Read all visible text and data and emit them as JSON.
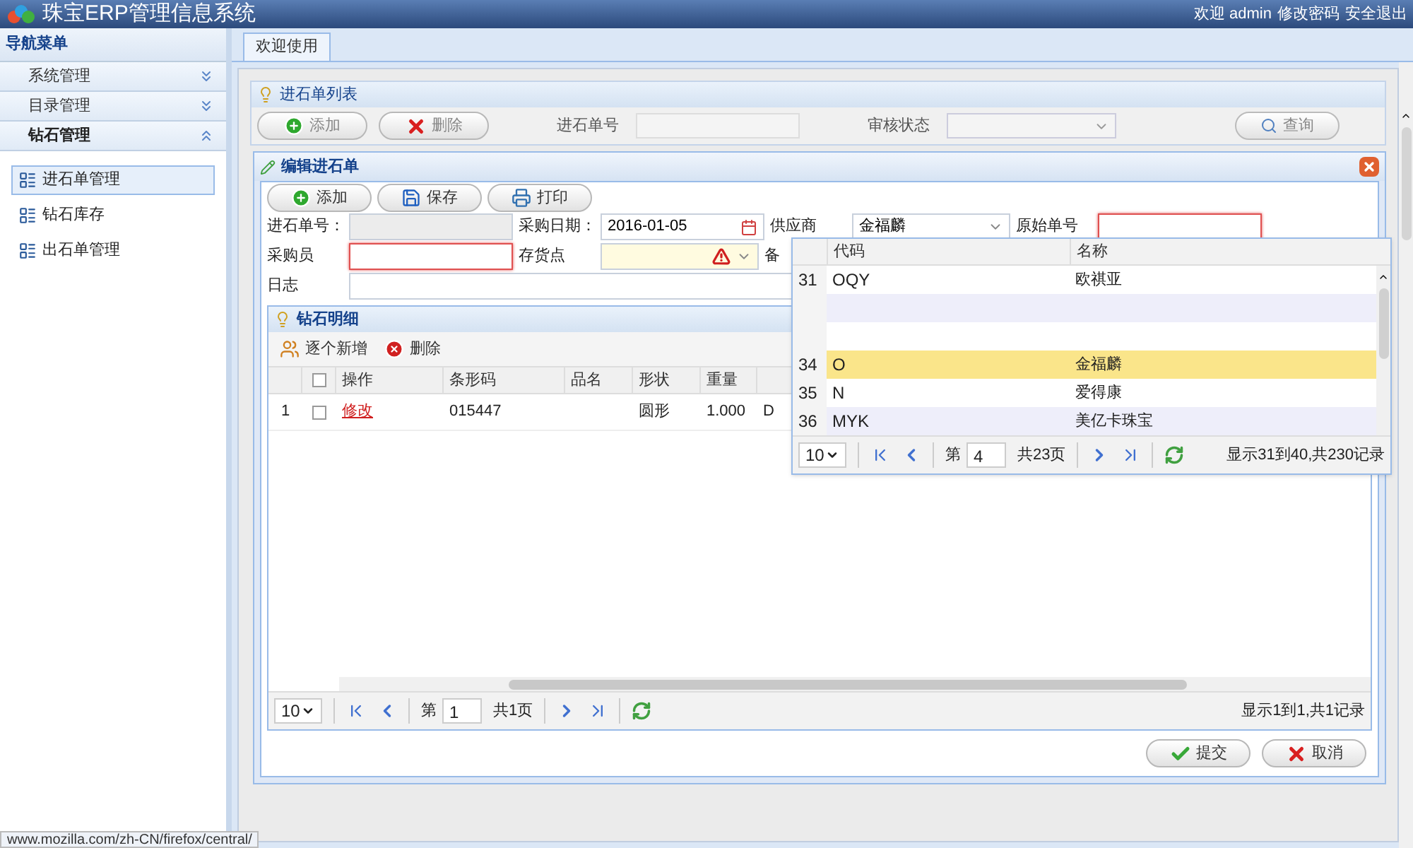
{
  "app_header": {
    "title": "珠宝ERP管理信息系统",
    "welcome": "欢迎 admin",
    "links": [
      "修改密码",
      "安全退出"
    ]
  },
  "sidebar": {
    "title": "导航菜单",
    "sections": [
      {
        "label": "系统管理",
        "expanded": false
      },
      {
        "label": "目录管理",
        "expanded": false
      },
      {
        "label": "钻石管理",
        "expanded": true,
        "children": [
          {
            "label": "进石单管理",
            "selected": true
          },
          {
            "label": "钻石库存",
            "selected": false
          },
          {
            "label": "出石单管理",
            "selected": false
          }
        ]
      }
    ]
  },
  "tabs": [
    {
      "label": "欢迎使用",
      "selected": true
    }
  ],
  "list_panel": {
    "title": "进石单列表",
    "buttons": [
      {
        "label": "添加",
        "kind": "add"
      },
      {
        "label": "删除",
        "kind": "delete"
      }
    ],
    "filters": [
      {
        "label": "进石单号",
        "kind": "text"
      },
      {
        "label": "审核状态",
        "kind": "select"
      }
    ],
    "search_button": "查询"
  },
  "dialog": {
    "title": "编辑进石单",
    "buttons": [
      {
        "label": "添加",
        "kind": "add"
      },
      {
        "label": "保存",
        "kind": "save"
      },
      {
        "label": "打印",
        "kind": "print"
      }
    ],
    "form_rows": [
      [
        {
          "label": "进石单号：",
          "kind": "readonly",
          "invalid": false
        },
        {
          "label": "采购日期：",
          "kind": "date",
          "value": "2016-01-05",
          "invalid": false
        },
        {
          "label": "供应商",
          "kind": "combo",
          "value": "金福麟",
          "invalid": false
        },
        {
          "label": "原始单号",
          "kind": "text",
          "invalid": true
        }
      ],
      [
        {
          "label": "采购员",
          "kind": "text",
          "invalid": true
        },
        {
          "label": "存货点",
          "kind": "combo",
          "invalid": true
        },
        {
          "label": "备",
          "kind": "covered"
        }
      ],
      [
        {
          "label": "日志",
          "kind": "wide",
          "invalid": false
        }
      ]
    ],
    "detail": {
      "title": "钻石明细",
      "buttons": [
        {
          "label": "逐个新增",
          "kind": "add-row"
        },
        {
          "label": "删除",
          "kind": "delete"
        }
      ],
      "select_all_checked": false,
      "columns": [
        "操作",
        "条形码",
        "品名",
        "形状",
        "重量"
      ],
      "rows": [
        {
          "row_number": "1",
          "checked": false,
          "action": "修改",
          "barcode": "015447",
          "shape": "圆形",
          "weight": "1.000",
          "column_7": "D"
        }
      ],
      "pager": {
        "page_size": "10",
        "page_prefix": "第",
        "page": "1",
        "total_pages": "共1页",
        "summary": "显示1到1,共1记录"
      }
    },
    "footer_buttons": [
      {
        "label": "提交",
        "kind": "submit"
      },
      {
        "label": "取消",
        "kind": "cancel"
      }
    ]
  },
  "supplier_dropdown": {
    "columns": [
      "代码",
      "名称"
    ],
    "rows": [
      {
        "row_number": "31",
        "code": "OQY",
        "name": "欧祺亚",
        "selected": false
      },
      {
        "selected": false
      },
      {
        "selected": false
      },
      {
        "row_number": "34",
        "code": "O",
        "name": "金福麟",
        "selected": true
      },
      {
        "row_number": "35",
        "code": "N",
        "name": "爱得康",
        "selected": false
      },
      {
        "row_number": "36",
        "code": "MYK",
        "name": "美亿卡珠宝",
        "selected": false
      }
    ],
    "pager": {
      "page_size": "10",
      "page_prefix": "第",
      "page": "4",
      "total_pages": "共23页",
      "summary": "显示31到40,共230记录"
    }
  },
  "status_bar": "www.mozilla.com/zh-CN/firefox/central/"
}
